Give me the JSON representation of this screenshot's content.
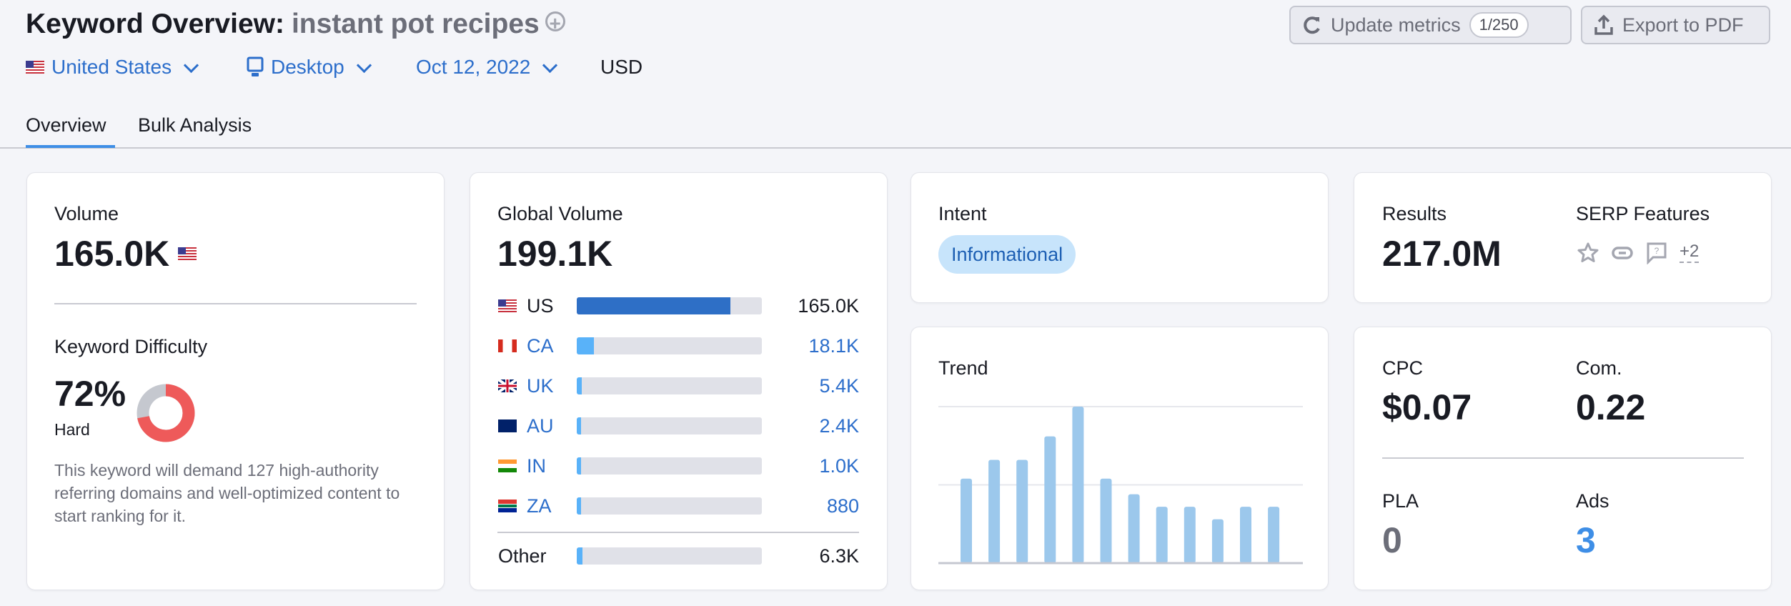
{
  "header": {
    "title": "Keyword Overview:",
    "keyword": "instant pot recipes",
    "add_icon": "plus-circle-icon",
    "filters": {
      "country": "United States",
      "device": "Desktop",
      "date": "Oct 12, 2022",
      "currency": "USD"
    },
    "update_button": {
      "label": "Update metrics",
      "counter": "1/250",
      "icon": "refresh-icon"
    },
    "export_button": {
      "label": "Export to PDF",
      "icon": "upload-icon"
    }
  },
  "tabs": [
    {
      "label": "Overview",
      "active": true
    },
    {
      "label": "Bulk Analysis",
      "active": false
    }
  ],
  "volume_card": {
    "label": "Volume",
    "value": "165.0K",
    "kd_label": "Keyword Difficulty",
    "kd_value": "72%",
    "kd_percent": 72,
    "kd_level": "Hard",
    "kd_description": "This keyword will demand 127 high-authority referring domains and well-optimized content to start ranking for it.",
    "colors": {
      "kd_fill": "#ee5a5a",
      "kd_track": "#c5c8cf"
    }
  },
  "global_volume_card": {
    "label": "Global Volume",
    "value": "199.1K",
    "countries": [
      {
        "code": "US",
        "value": "165.0K",
        "share": 0.83,
        "flag": "us"
      },
      {
        "code": "CA",
        "value": "18.1K",
        "share": 0.091,
        "flag": "ca"
      },
      {
        "code": "UK",
        "value": "5.4K",
        "share": 0.027,
        "flag": "uk"
      },
      {
        "code": "AU",
        "value": "2.4K",
        "share": 0.012,
        "flag": "au"
      },
      {
        "code": "IN",
        "value": "1.0K",
        "share": 0.005,
        "flag": "in"
      },
      {
        "code": "ZA",
        "value": "880",
        "share": 0.004,
        "flag": "za"
      }
    ],
    "other": {
      "label": "Other",
      "value": "6.3K",
      "share": 0.032
    },
    "colors": {
      "primary": "#2e6fc6",
      "secondary": "#59b2f9",
      "track": "#e0e1e8"
    }
  },
  "intent_card": {
    "label": "Intent",
    "badge": "Informational"
  },
  "trend_card": {
    "label": "Trend",
    "relative_values": [
      54,
      66,
      66,
      81,
      100,
      54,
      44,
      36,
      36,
      28,
      36,
      36
    ],
    "bar_color": "#9cc8ec"
  },
  "results_card": {
    "label": "Results",
    "value": "217.0M",
    "serp_label": "SERP Features",
    "serp_icons": [
      "star-icon",
      "link-icon",
      "question-bubble-icon"
    ],
    "serp_more": "+2"
  },
  "cpc_card": {
    "cpc_label": "CPC",
    "cpc_value": "$0.07",
    "com_label": "Com.",
    "com_value": "0.22",
    "pla_label": "PLA",
    "pla_value": "0",
    "ads_label": "Ads",
    "ads_value": "3"
  }
}
